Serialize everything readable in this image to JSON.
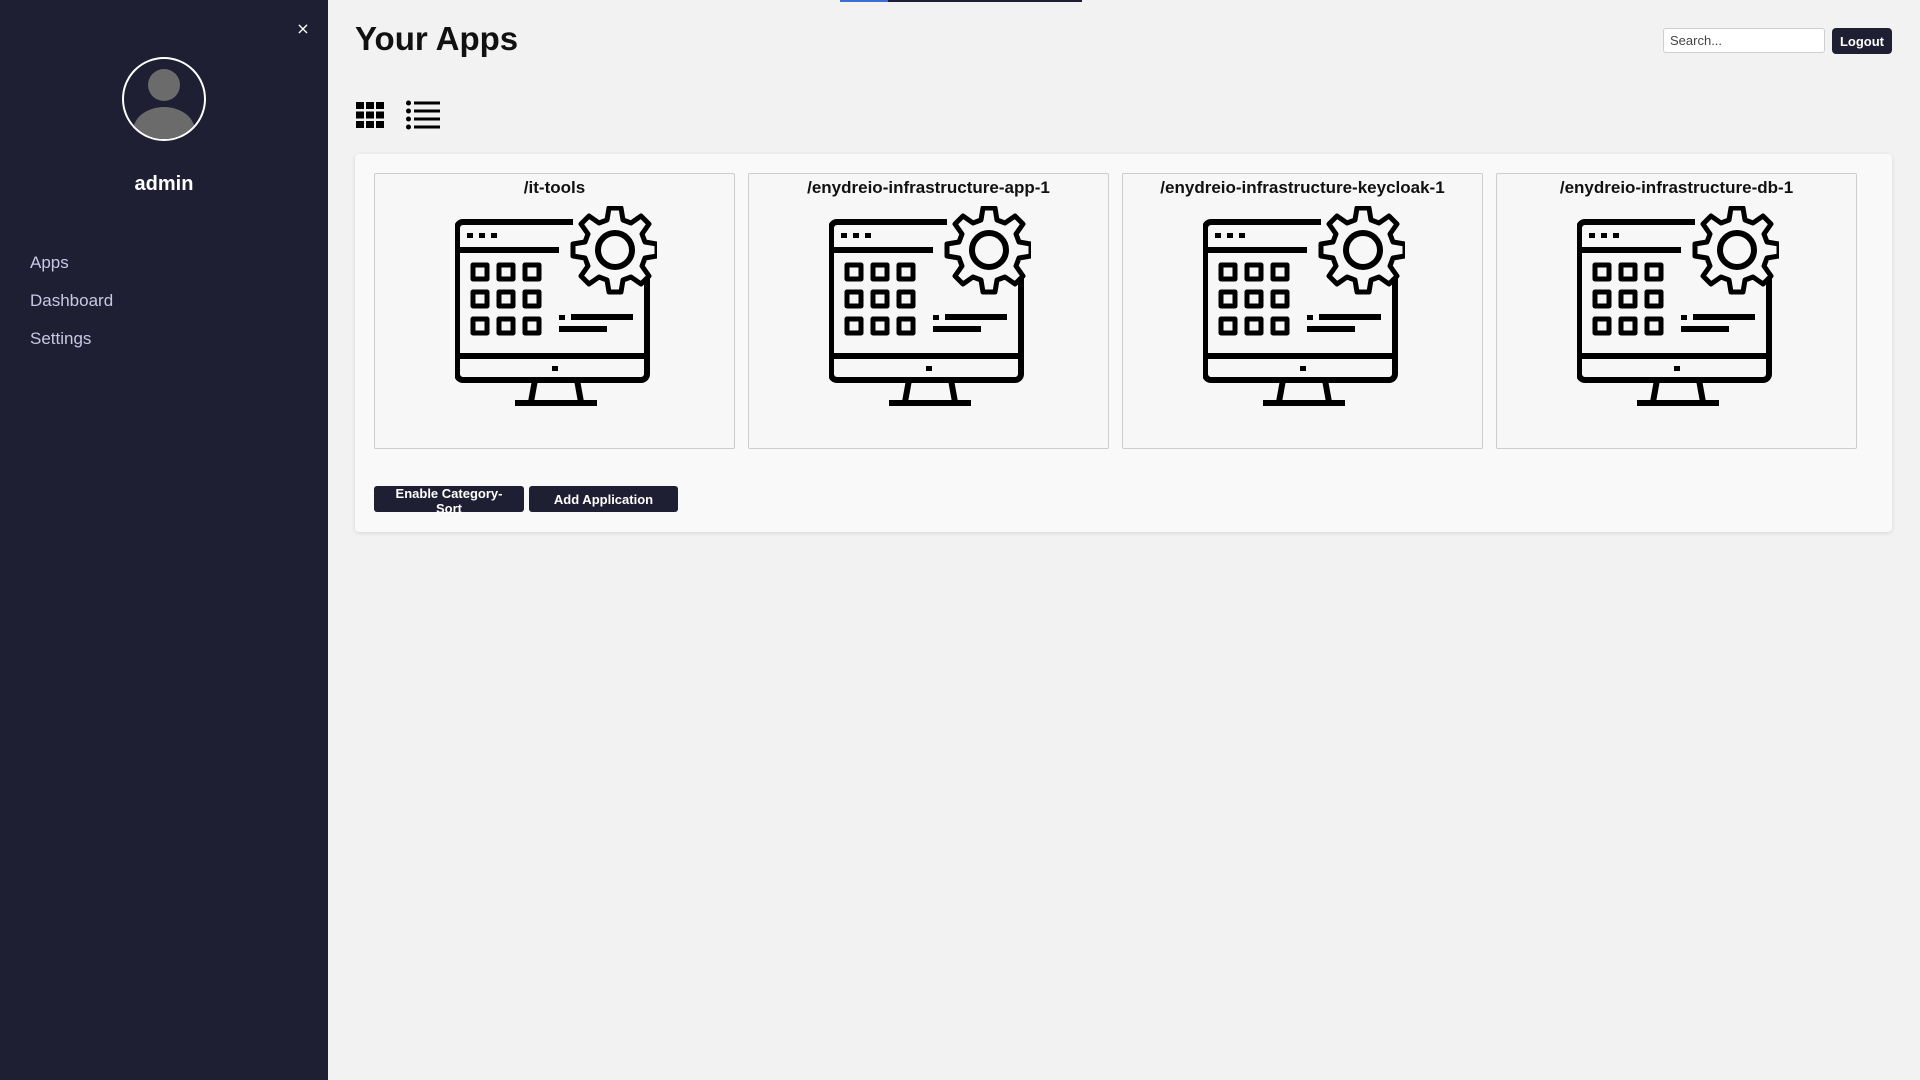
{
  "sidebar": {
    "close_glyph": "×",
    "username": "admin",
    "avatar_icon": "user-avatar-icon",
    "nav": [
      {
        "label": "Apps"
      },
      {
        "label": "Dashboard"
      },
      {
        "label": "Settings"
      }
    ]
  },
  "header": {
    "title": "Your Apps",
    "search_placeholder": "Search...",
    "logout_label": "Logout"
  },
  "view_toggle": {
    "grid_icon": "grid-view-icon",
    "list_icon": "list-view-icon"
  },
  "apps": [
    {
      "name": "/it-tools",
      "icon": "app-settings-monitor-icon"
    },
    {
      "name": "/enydreio-infrastructure-app-1",
      "icon": "app-settings-monitor-icon"
    },
    {
      "name": "/enydreio-infrastructure-keycloak-1",
      "icon": "app-settings-monitor-icon"
    },
    {
      "name": "/enydreio-infrastructure-db-1",
      "icon": "app-settings-monitor-icon"
    }
  ],
  "actions": {
    "category_sort_label": "Enable Category-Sort",
    "add_application_label": "Add Application"
  },
  "colors": {
    "sidebar_bg": "#1f1f33",
    "page_bg": "#f2f2f2",
    "accent": "#3a6fd8"
  }
}
